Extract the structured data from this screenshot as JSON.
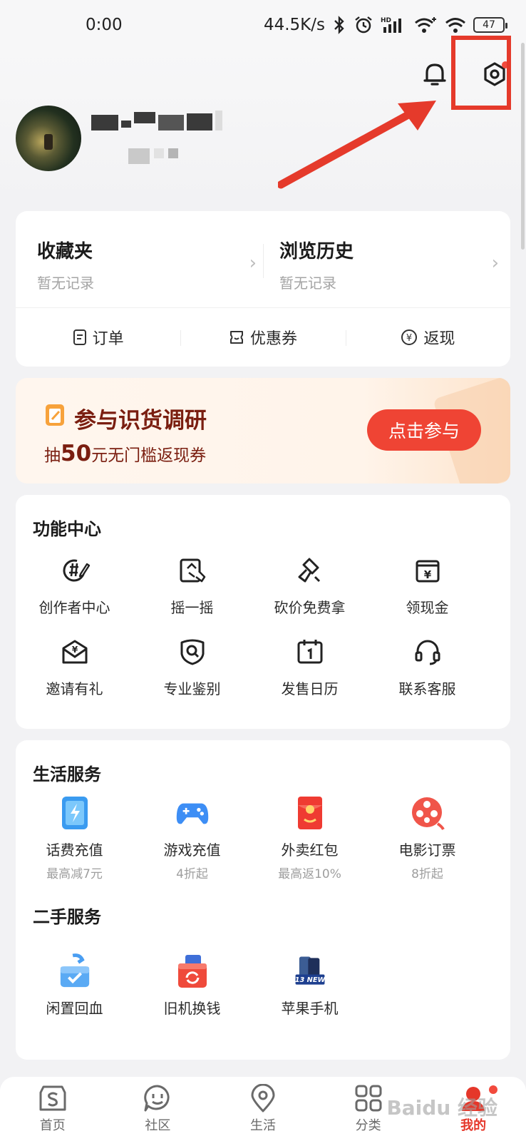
{
  "status_bar": {
    "time": "0:00",
    "network_speed": "44.5K/s",
    "battery": "47",
    "icons": [
      "bluetooth-icon",
      "alarm-icon",
      "hd-signal-icon",
      "wifi-plus-icon",
      "wifi-icon"
    ]
  },
  "header": {
    "icons": [
      "bell-icon",
      "settings-icon"
    ]
  },
  "favorites": {
    "items": [
      {
        "title": "收藏夹",
        "sub": "暂无记录"
      },
      {
        "title": "浏览历史",
        "sub": "暂无记录"
      }
    ],
    "quick": [
      {
        "label": "订单",
        "icon": "order-icon"
      },
      {
        "label": "优惠券",
        "icon": "coupon-icon"
      },
      {
        "label": "返现",
        "icon": "cashback-icon"
      }
    ]
  },
  "banner": {
    "title": "参与识货调研",
    "sub_prefix": "抽",
    "sub_amount": "50",
    "sub_suffix": "元无门槛返现券",
    "button": "点击参与"
  },
  "function_center": {
    "title": "功能中心",
    "items": [
      {
        "label": "创作者中心",
        "icon": "creator-icon"
      },
      {
        "label": "摇一摇",
        "icon": "shake-icon"
      },
      {
        "label": "砍价免费拿",
        "icon": "bargain-icon"
      },
      {
        "label": "领现金",
        "icon": "cash-icon"
      },
      {
        "label": "邀请有礼",
        "icon": "invite-icon"
      },
      {
        "label": "专业鉴别",
        "icon": "identify-icon"
      },
      {
        "label": "发售日历",
        "icon": "calendar-icon"
      },
      {
        "label": "联系客服",
        "icon": "headset-icon"
      }
    ]
  },
  "life_services": {
    "title": "生活服务",
    "items": [
      {
        "label": "话费充值",
        "sub": "最高减7元",
        "icon": "phone-recharge-icon",
        "color": "#3a9bf0"
      },
      {
        "label": "游戏充值",
        "sub": "4折起",
        "icon": "gamepad-icon",
        "color": "#3d8ef5"
      },
      {
        "label": "外卖红包",
        "sub": "最高返10%",
        "icon": "red-envelope-icon",
        "color": "#ef3b32"
      },
      {
        "label": "电影订票",
        "sub": "8折起",
        "icon": "film-reel-icon",
        "color": "#f0554a"
      }
    ]
  },
  "second_hand": {
    "title": "二手服务",
    "items": [
      {
        "label": "闲置回血",
        "icon": "recycle-box-icon"
      },
      {
        "label": "旧机换钱",
        "icon": "trade-in-icon"
      },
      {
        "label": "苹果手机",
        "icon": "iphone13-icon",
        "badge": "13 NEW"
      }
    ]
  },
  "bottom_nav": {
    "items": [
      {
        "label": "首页",
        "icon": "home-icon"
      },
      {
        "label": "社区",
        "icon": "community-icon"
      },
      {
        "label": "生活",
        "icon": "location-icon"
      },
      {
        "label": "分类",
        "icon": "grid-icon"
      },
      {
        "label": "我的",
        "icon": "profile-icon"
      }
    ],
    "active": "我的"
  },
  "watermark": "Baidu 经验"
}
